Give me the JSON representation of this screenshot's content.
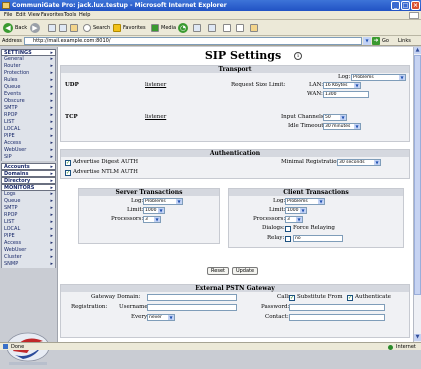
{
  "window": {
    "title": "CommuniGate Pro: jack.lux.testup - Microsoft Internet Explorer"
  },
  "menu": [
    "File",
    "Edit",
    "View",
    "Favorites",
    "Tools",
    "Help"
  ],
  "toolbar": {
    "back": "Back",
    "search": "Search",
    "favorites": "Favorites",
    "media": "Media"
  },
  "address": {
    "label": "Address",
    "url": "http://mail.example.com:8010/",
    "go": "Go",
    "links": "Links"
  },
  "sidebar": {
    "groups": [
      {
        "title": "SETTINGS",
        "items": [
          "General",
          "Router",
          "Protection",
          "Rules",
          "Queue",
          "Events",
          "Obscure",
          "SMTP",
          "RPOP",
          "LIST",
          "LOCAL",
          "PIPE",
          "Access",
          "WebUser",
          "SIP"
        ]
      },
      {
        "title": "Accounts",
        "items": []
      },
      {
        "title": "Domains",
        "items": []
      },
      {
        "title": "Directory",
        "items": []
      },
      {
        "title": "MONITORS",
        "items": [
          "Logs",
          "Queue",
          "SMTP",
          "RPOP",
          "LIST",
          "LOCAL",
          "PIPE",
          "Access",
          "WebUser",
          "Cluster",
          "SNMP"
        ]
      }
    ]
  },
  "page": {
    "title": "SIP Settings"
  },
  "transport": {
    "header": "Transport",
    "log_label": "Log:",
    "log_value": "Problems",
    "udp": {
      "name": "UDP",
      "link": "listener",
      "request_size_label": "Request Size Limit:",
      "lan_label": "LAN:",
      "lan_value": "16 Kbytes",
      "wan_label": "WAN:",
      "wan_value": "1300"
    },
    "tcp": {
      "name": "TCP",
      "link": "listener",
      "input_channels_label": "Input Channels:",
      "input_channels_value": "50",
      "idle_timeout_label": "Idle Timeout:",
      "idle_timeout_value": "30 minutes"
    }
  },
  "authentication": {
    "header": "Authentication",
    "digest_label": "Advertise Digest AUTH",
    "digest_checked": true,
    "ntlm_label": "Advertise NTLM AUTH",
    "ntlm_checked": true,
    "minimal_registration_label": "Minimal Registration:",
    "minimal_registration_value": "30 seconds"
  },
  "server_transactions": {
    "header": "Server Transactions",
    "log_label": "Log:",
    "log_value": "Problems",
    "limit_label": "Limit:",
    "limit_value": "1000",
    "processors_label": "Processors:",
    "processors_value": "3"
  },
  "client_transactions": {
    "header": "Client Transactions",
    "log_label": "Log:",
    "log_value": "Problems",
    "limit_label": "Limit:",
    "limit_value": "1000",
    "processors_label": "Processors:",
    "processors_value": "3",
    "dialogs_label": "Dialogs:",
    "force_relaying_label": "Force Relaying",
    "relay_label": "Relay:",
    "relay_value": "no"
  },
  "buttons": {
    "reset": "Reset",
    "update": "Update"
  },
  "pstn": {
    "header": "External PSTN Gateway",
    "gateway_domain_label": "Gateway Domain:",
    "registration_label": "Registration:",
    "username_label": "Username:",
    "every_label": "Every:",
    "every_value": "never",
    "calls_label": "Calls:",
    "substitute_from_label": "Substitute From",
    "substitute_from_checked": true,
    "authenticate_label": "Authenticate",
    "authenticate_checked": true,
    "password_label": "Password:",
    "contact_label": "Contact:"
  },
  "status": {
    "left": "Done",
    "right": "Internet"
  }
}
